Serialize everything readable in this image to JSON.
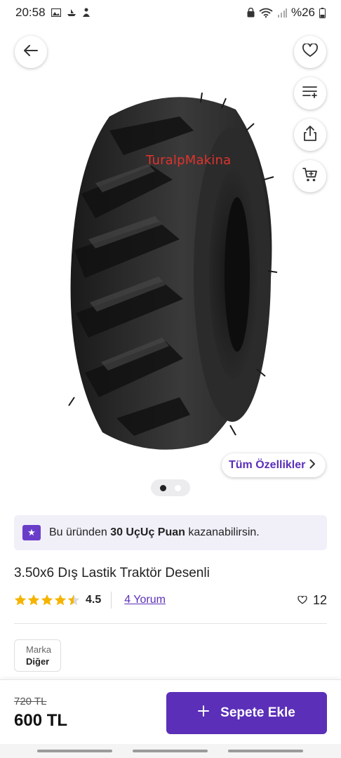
{
  "status_bar": {
    "time": "20:58",
    "battery": "%26",
    "left_icons": [
      "gallery-icon",
      "boat-icon",
      "person-icon"
    ],
    "right_icons": [
      "lock-icon",
      "wifi-icon",
      "signal-icon",
      "battery-icon"
    ]
  },
  "hero": {
    "watermark": "TuralpMakina",
    "image_subject": "tractor tire",
    "carousel": {
      "total": 2,
      "active": 0
    }
  },
  "actions": {
    "back": "back-arrow-icon",
    "favorite": "heart-icon",
    "add_to_list": "list-add-icon",
    "share": "share-icon",
    "cart": "cart-icon"
  },
  "features_button": "Tüm Özellikler",
  "points_banner": {
    "prefix": "Bu üründen",
    "highlight": "30 UçUç Puan",
    "suffix": "kazanabilirsin."
  },
  "product": {
    "title": "3.50x6 Dış Lastik Traktör Desenli",
    "rating": "4.5",
    "rating_value": 4.5,
    "rating_max": 5,
    "reviews_link": "4 Yorum",
    "likes": "12"
  },
  "brand": {
    "label": "Marka",
    "value": "Diğer"
  },
  "purchase": {
    "old_price": "720 TL",
    "price": "600 TL",
    "button": "Sepete Ekle"
  },
  "colors": {
    "accent": "#5b2fb8",
    "banner_bg": "#f1eff8",
    "star": "#f5b400",
    "watermark": "#e0332d"
  }
}
